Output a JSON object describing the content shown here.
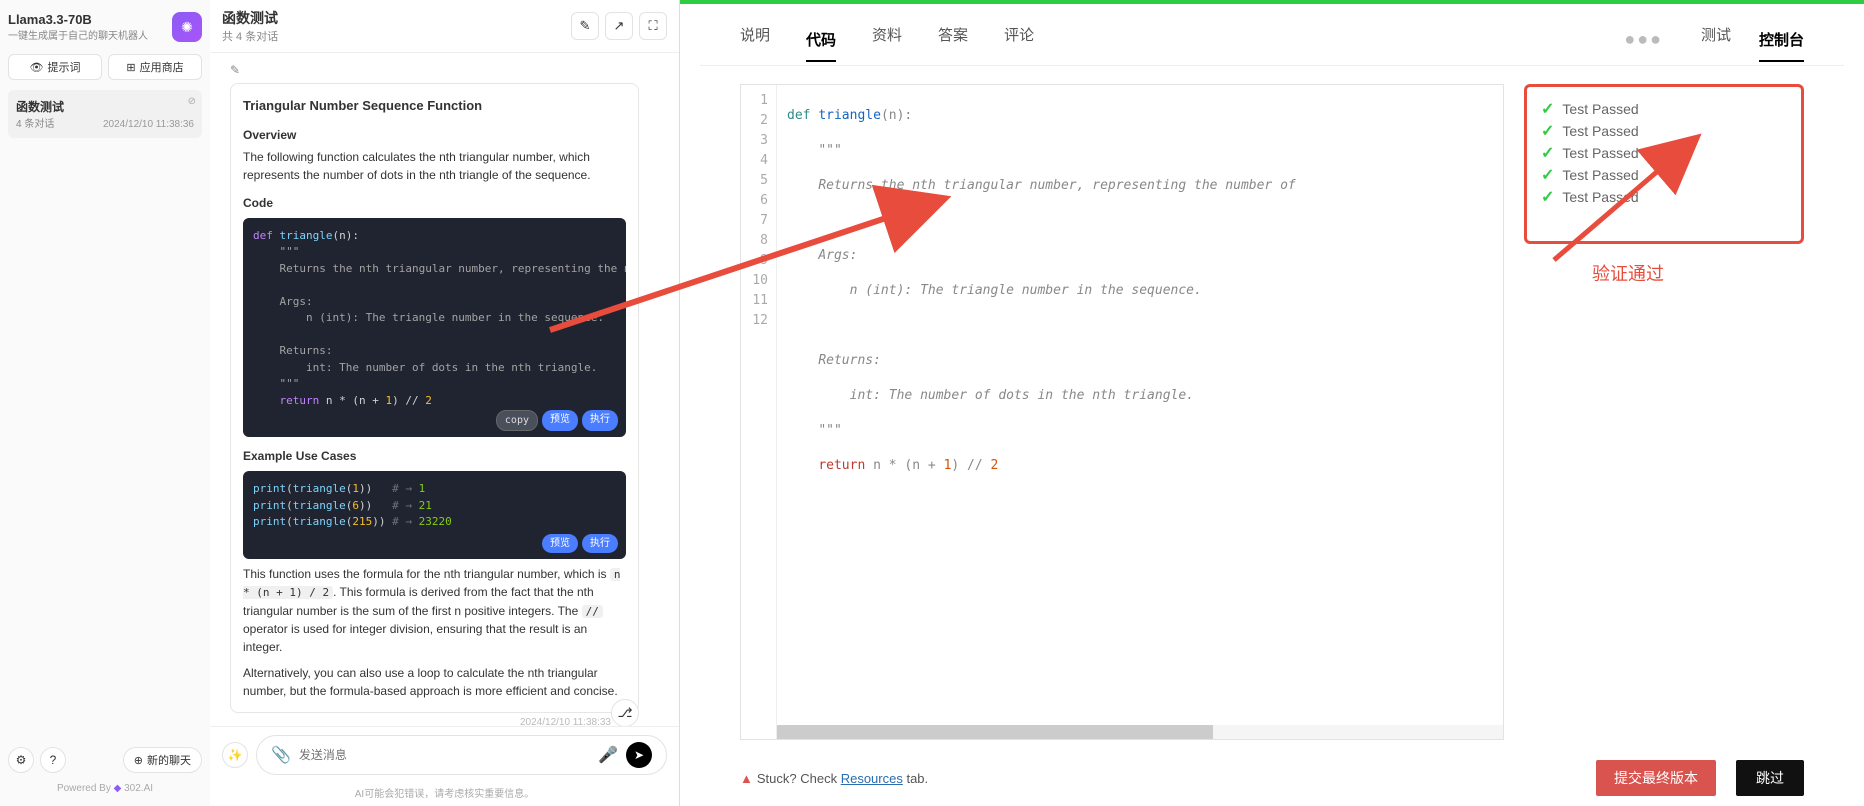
{
  "sidebar": {
    "model_title": "Llama3.3-70B",
    "model_sub": "一键生成属于自己的聊天机器人",
    "btn_prompt": "提示词",
    "btn_store": "应用商店",
    "convo": {
      "title": "函数测试",
      "sub": "4 条对话",
      "time": "2024/12/10 11:38:36"
    },
    "new_chat": "新的聊天",
    "powered": "Powered By",
    "powered_brand": "302.AI"
  },
  "chat": {
    "title": "函数测试",
    "sub": "共 4 条对话",
    "msg": {
      "h": "Triangular Number Sequence Function",
      "overview_h": "Overview",
      "overview_p": "The following function calculates the nth triangular number, which represents the number of dots in the nth triangle of the sequence.",
      "code_h": "Code",
      "examples_h": "Example Use Cases",
      "p2a": "This function uses the formula for the nth triangular number, which is ",
      "p2_code1": "n * (n + 1) / 2",
      "p2b": ". This formula is derived from the fact that the nth triangular number is the sum of the first n positive integers. The ",
      "p2_code2": "//",
      "p2c": " operator is used for integer division, ensuring that the result is an integer.",
      "p3": "Alternatively, you can also use a loop to calculate the nth triangular number, but the formula-based approach is more efficient and concise.",
      "time": "2024/12/10 11:38:33"
    },
    "actions": {
      "copy": "copy",
      "preview": "预览",
      "run": "执行"
    },
    "input_placeholder": "发送消息",
    "disclaimer": "AI可能会犯错误，请考虑核实重要信息。"
  },
  "editor_tabs": {
    "explain": "说明",
    "code": "代码",
    "resources": "资料",
    "answer": "答案",
    "comments": "评论",
    "test": "测试",
    "console": "控制台"
  },
  "editor": {
    "lines": [
      "1",
      "2",
      "3",
      "4",
      "5",
      "6",
      "7",
      "8",
      "9",
      "10",
      "11",
      "12"
    ]
  },
  "results": {
    "items": [
      "Test Passed",
      "Test Passed",
      "Test Passed",
      "Test Passed",
      "Test Passed"
    ],
    "verify_label": "验证通过"
  },
  "bottom": {
    "stuck_a": "Stuck? Check ",
    "stuck_link": "Resources",
    "stuck_b": " tab.",
    "submit": "提交最终版本",
    "skip": "跳过"
  }
}
